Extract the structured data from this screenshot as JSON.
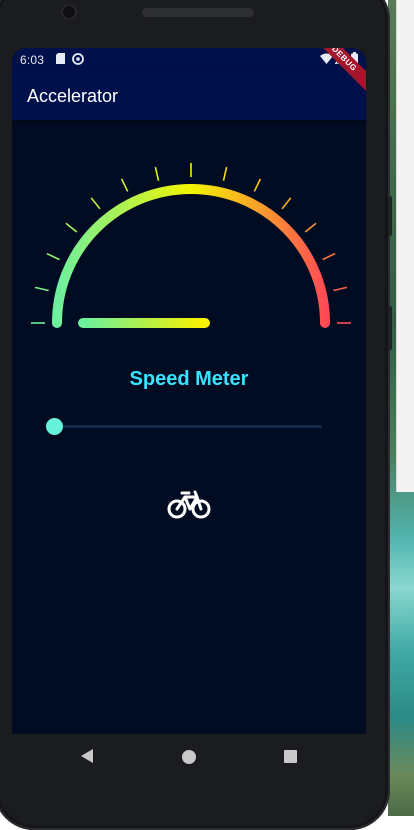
{
  "statusbar": {
    "time": "6:03",
    "icons": [
      "sd-card-icon",
      "sync-icon",
      "wifi-icon",
      "signal-icon",
      "battery-icon"
    ]
  },
  "appbar": {
    "title": "Accelerator",
    "debug_banner": "DEBUG"
  },
  "gauge": {
    "label": "Speed Meter",
    "value_fraction": 0.0,
    "gradient_colors": [
      "#6cf0a0",
      "#f2f500",
      "#ff4a55"
    ],
    "needle_gradient": [
      "#6cf09a",
      "#f7f000"
    ]
  },
  "slider": {
    "value_fraction": 0.0,
    "thumb_color": "#67f2dc",
    "track_color": "#13294d"
  },
  "vehicle": {
    "icon": "bicycle-icon"
  },
  "navigation": {
    "buttons": [
      "back-icon",
      "home-icon",
      "recents-icon"
    ]
  },
  "colors": {
    "screen_bg": "#010b22",
    "appbar_bg": "#00104a",
    "accent": "#37e3ff"
  }
}
